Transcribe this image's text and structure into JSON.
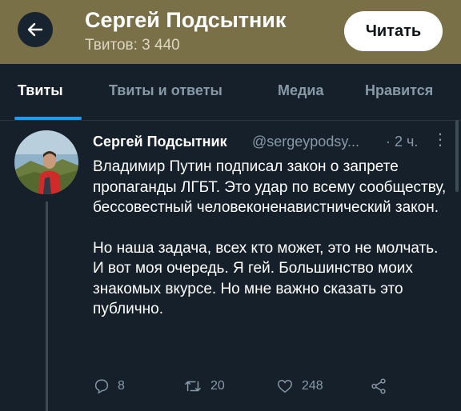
{
  "header": {
    "name": "Сергей Подсытник",
    "tweet_count": "Твитов: 3 440",
    "follow_label": "Читать"
  },
  "tabs": [
    {
      "label": "Твиты"
    },
    {
      "label": "Твиты и ответы"
    },
    {
      "label": "Медиа"
    },
    {
      "label": "Нравится"
    }
  ],
  "tweet": {
    "author": "Сергей Подсытник",
    "handle": "@sergeypodsy...",
    "time": "· 2 ч.",
    "paragraph1": "Владимир Путин подписал закон о запрете пропаганды ЛГБТ. Это удар по всему сообществу, бессовестный человеконенавистнический закон.",
    "paragraph2": "Но наша задача, всех кто может, это не молчать. И вот моя очередь. Я гей. Большинство моих знакомых вкурсе. Но мне важно сказать это публично.",
    "replies": "8",
    "retweets": "20",
    "likes": "248"
  },
  "colors": {
    "header_bg": "#7a7047",
    "page_bg": "#15202b",
    "accent": "#1d9bf0",
    "muted": "#8899a6"
  },
  "icons": [
    "back-arrow-icon",
    "more-icon",
    "reply-icon",
    "retweet-icon",
    "like-icon",
    "share-icon"
  ]
}
